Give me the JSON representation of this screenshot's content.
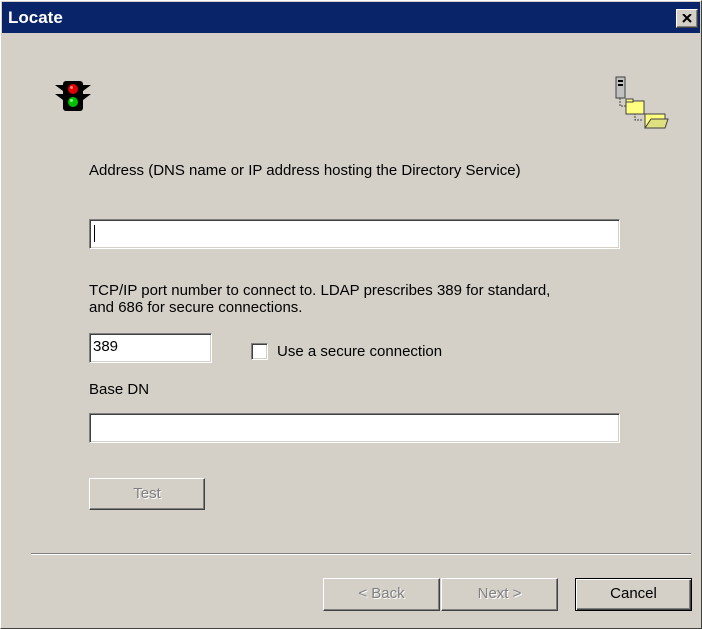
{
  "window": {
    "title": "Locate",
    "close_glyph": "✕"
  },
  "icons": {
    "header_left": "traffic-light-icon",
    "header_right": "directory-tree-icon"
  },
  "address": {
    "label": "Address (DNS name or IP address hosting the Directory Service)",
    "value": ""
  },
  "port": {
    "label_line1": "TCP/IP port number to connect to. LDAP prescribes 389 for standard,",
    "label_line2": "and 686 for secure connections.",
    "value": "389"
  },
  "secure": {
    "label": "Use a secure connection",
    "checked": false
  },
  "base_dn": {
    "label": "Base DN",
    "value": ""
  },
  "buttons": {
    "test": "Test",
    "back": "< Back",
    "next": "Next >",
    "cancel": "Cancel"
  },
  "colors": {
    "titlebar": "#0a246a",
    "face": "#d4d0c8",
    "disabled_text": "#808080"
  }
}
